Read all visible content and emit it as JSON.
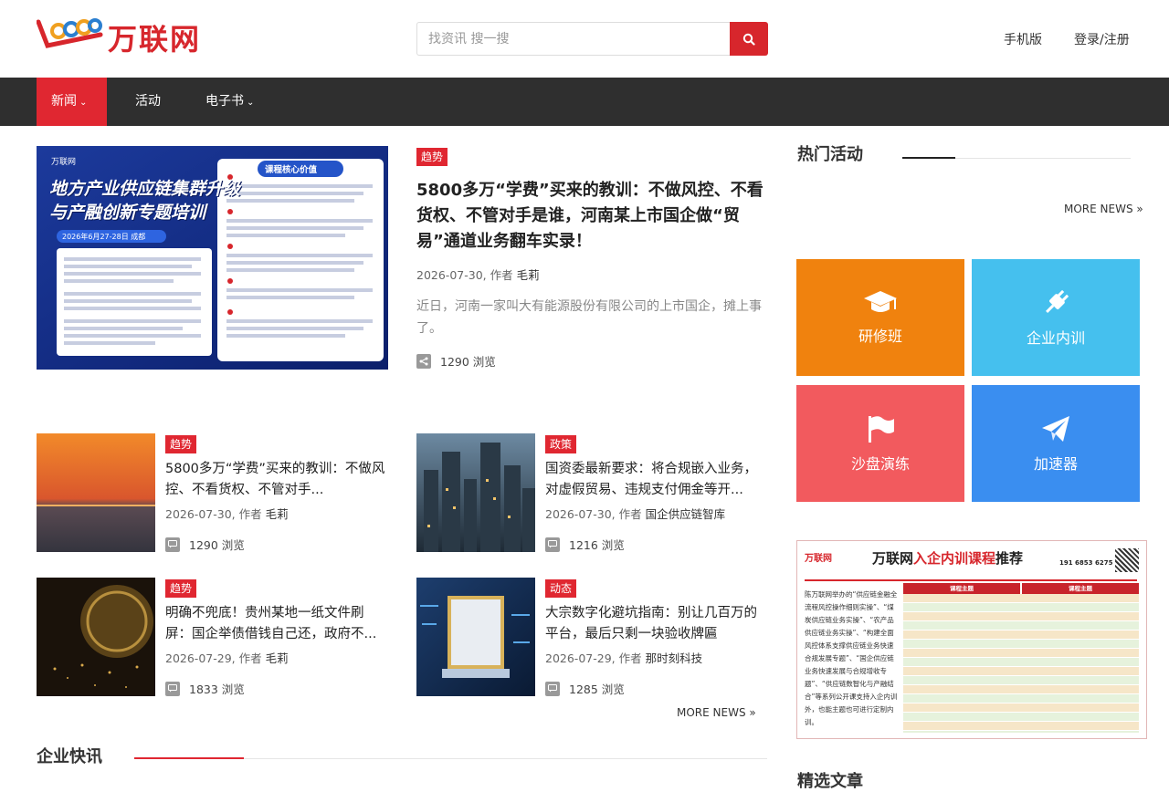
{
  "header": {
    "brand": "万联网",
    "search_placeholder": "找资讯 搜一搜",
    "mobile_link": "手机版",
    "login_link": "登录/注册"
  },
  "nav": {
    "items": [
      {
        "label": "新闻",
        "has_caret": true,
        "active": true
      },
      {
        "label": "活动",
        "has_caret": false,
        "active": false
      },
      {
        "label": "电子书",
        "has_caret": true,
        "active": false
      }
    ],
    "caret": "⌄"
  },
  "featured": {
    "image": {
      "brand": "万联网",
      "headline_line1": "地方产业供应链集群升级",
      "headline_line2": "与产融创新专题培训",
      "panel_title": "课程核心价值",
      "date_line": "2026年6月27-28日 成都"
    },
    "tag": "趋势",
    "title": "5800多万“学费”买来的教训：不做风控、不看货权、不管对手是谁，河南某上市国企做“贸易”通道业务翻车实录！",
    "date": "2026-07-30,",
    "author_label": "作者",
    "author": "毛莉",
    "summary": "近日，河南一家叫大有能源股份有限公司的上市国企，摊上事了。",
    "views": "1290",
    "views_label": "浏览"
  },
  "news_cards": [
    {
      "tag": "趋势",
      "title": "5800多万“学费”买来的教训：不做风控、不看货权、不管对手...",
      "date": "2026-07-30,",
      "author": "毛莉",
      "views": "1290"
    },
    {
      "tag": "政策",
      "title": "国资委最新要求：将合规嵌入业务，对虚假贸易、违规支付佣金等开...",
      "date": "2026-07-30,",
      "author": "国企供应链智库",
      "views": "1216"
    },
    {
      "tag": "趋势",
      "title": "明确不兜底！贵州某地一纸文件刷屏：国企举债借钱自己还，政府不...",
      "date": "2026-07-29,",
      "author": "毛莉",
      "views": "1833"
    },
    {
      "tag": "动态",
      "title": "大宗数字化避坑指南：别让几百万的平台，最后只剩一块验收牌匾",
      "date": "2026-07-29,",
      "author": "那时刻科技",
      "views": "1285"
    }
  ],
  "author_label": "作者",
  "views_label": "浏览",
  "more_news": "MORE NEWS »",
  "sections": {
    "hot_events": "热门活动",
    "company_news": "企业快讯",
    "selected_articles": "精选文章"
  },
  "tiles": [
    {
      "label": "研修班",
      "icon": "graduation-cap-icon",
      "color": "#f0820e"
    },
    {
      "label": "企业内训",
      "icon": "plug-icon",
      "color": "#45c0ee"
    },
    {
      "label": "沙盘演练",
      "icon": "flag-icon",
      "color": "#f25a5e"
    },
    {
      "label": "加速器",
      "icon": "paper-plane-icon",
      "color": "#3a8ef0"
    }
  ],
  "ad": {
    "brand": "万联网",
    "title_prefix": "万联网",
    "title_highlight": "入企内训课程",
    "title_suffix": "推荐",
    "contact": "191 6853 6275",
    "col1": "课程主题",
    "col2": "课程主题",
    "left_text": "陈万联网举办的“供应链金融全流程风控操作细则实操”、“煤炭供应链业务实操”、“农产品供应链业务实操”、“构建全面风控体系支撑供应链业务快速合规发展专题”、“国企供应链业务快速发展与合规增收专题”、“供应链数智化与产融结合”等系列公开课支持入企内训外，也能主题也可进行定制内训。"
  },
  "colors": {
    "accent": "#e02731",
    "nav_bg": "#2f2f2f",
    "hot_line": "#222222",
    "company_line": "#e02731"
  }
}
